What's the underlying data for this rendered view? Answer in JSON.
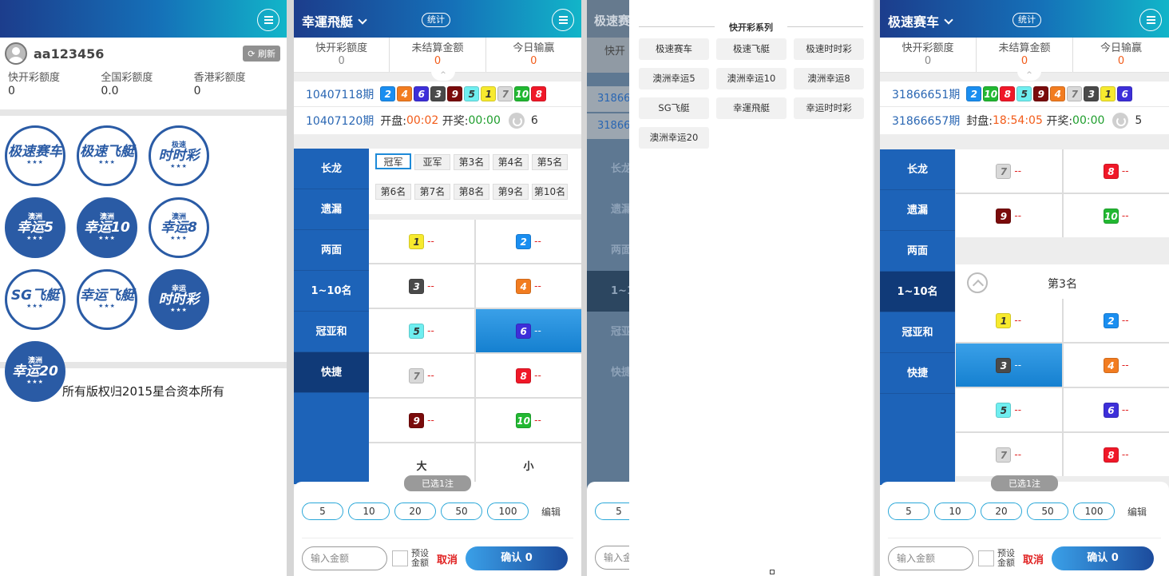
{
  "panel1": {
    "username": "aa123456",
    "refresh_label": "刷新",
    "limits": [
      {
        "label": "快开彩额度",
        "value": "0"
      },
      {
        "label": "全国彩额度",
        "value": "0.0"
      },
      {
        "label": "香港彩额度",
        "value": "0"
      }
    ],
    "logos": [
      {
        "top": "",
        "main": "极速赛车"
      },
      {
        "top": "",
        "main": "极速飞艇"
      },
      {
        "top": "极速",
        "main": "时时彩"
      },
      {
        "top": "澳洲",
        "main": "幸运5"
      },
      {
        "top": "澳洲",
        "main": "幸运10"
      },
      {
        "top": "澳洲",
        "main": "幸运8"
      },
      {
        "top": "",
        "main": "SG飞艇"
      },
      {
        "top": "",
        "main": "幸运飞艇"
      },
      {
        "top": "幸运",
        "main": "时时彩"
      },
      {
        "top": "澳洲",
        "main": "幸运20"
      }
    ],
    "copyright": "所有版权归2015星合资本所有"
  },
  "common": {
    "stat_label": "统计",
    "stats_labels": [
      "快开彩额度",
      "未结算金额",
      "今日输赢"
    ],
    "stats_values": [
      "0",
      "0",
      "0"
    ],
    "side_items": [
      "长龙",
      "遗漏",
      "两面",
      "1~10名",
      "冠亚和",
      "快捷"
    ],
    "selected_count": "已选1注",
    "chips": [
      "5",
      "10",
      "20",
      "50",
      "100"
    ],
    "edit_label": "编辑",
    "amount_placeholder": "输入金额",
    "preset_label": "预设金额",
    "cancel_label": "取消",
    "confirm_label": "确认 0",
    "caret": "^"
  },
  "panel2": {
    "title": "幸運飛艇",
    "last_period": "10407118期",
    "last_balls": [
      "2",
      "4",
      "6",
      "3",
      "9",
      "5",
      "1",
      "7",
      "10",
      "8"
    ],
    "cur_period": "10407120期",
    "open_label": "开盘:",
    "open_time": "00:02",
    "draw_label": "开奖:",
    "draw_time": "00:00",
    "count": "6",
    "tabs_row1": [
      "冠军",
      "亚军",
      "第3名",
      "第4名",
      "第5名"
    ],
    "tabs_row2": [
      "第6名",
      "第7名",
      "第8名",
      "第9名",
      "第10名"
    ],
    "grid_balls": [
      "1",
      "2",
      "3",
      "4",
      "5",
      "6",
      "7",
      "8",
      "9",
      "10"
    ],
    "odds": "--",
    "big": "大",
    "small": "小"
  },
  "panel3": {
    "dim_title": "极速赛",
    "dim_sub": "快开",
    "dim_period1": "31866",
    "dim_period2": "31866",
    "dim_side": [
      "长龙",
      "遗漏",
      "两面",
      "1~10",
      "冠亚",
      "快捷"
    ],
    "dropdown_title": "快开彩系列",
    "dropdown_items": [
      "极速赛车",
      "极速飞艇",
      "极速时时彩",
      "澳洲幸运5",
      "澳洲幸运10",
      "澳洲幸运8",
      "SG飞艇",
      "幸運飛艇",
      "幸运时时彩",
      "澳洲幸运20"
    ],
    "chip": "5",
    "amount_placeholder": "输入金"
  },
  "panel4": {
    "title": "极速赛车",
    "last_period": "31866651期",
    "last_balls": [
      "2",
      "10",
      "8",
      "5",
      "9",
      "4",
      "7",
      "3",
      "1",
      "6"
    ],
    "cur_period": "31866657期",
    "open_label": "封盘:",
    "open_time": "18:54:05",
    "draw_label": "开奖:",
    "draw_time": "00:00",
    "count": "5",
    "top_grid": [
      "7",
      "8",
      "9",
      "10"
    ],
    "section_title": "第3名",
    "grid_balls": [
      "1",
      "2",
      "3",
      "4",
      "5",
      "6",
      "7",
      "8"
    ],
    "odds": "--"
  }
}
